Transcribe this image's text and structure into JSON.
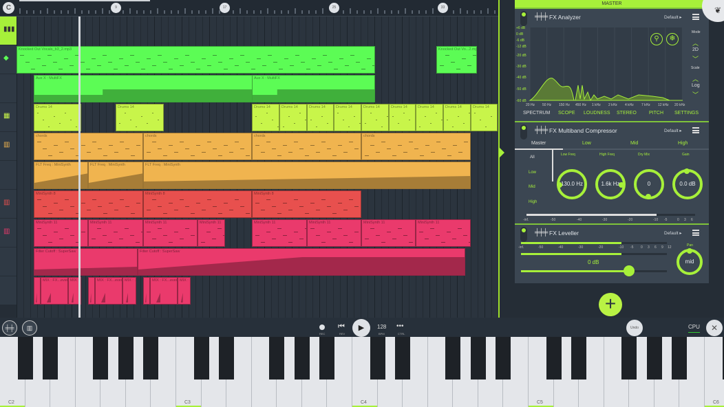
{
  "ruler": {
    "markers": [
      "9",
      "17",
      "25",
      "33"
    ]
  },
  "colors": {
    "accent": "#a7f03a",
    "vocals": "#5cfc55",
    "aux": "#5cfc55",
    "drums": "#c8f54a",
    "chords": "#f0b44f",
    "flt": "#f0b44f",
    "minisynth8": "#e8504e",
    "minisynth11": "#ea3a6c",
    "filter": "#ea3a6c",
    "mix": "#ea3a6c"
  },
  "tracks": [
    {
      "id": "master",
      "icon": "bars-icon",
      "clips": []
    },
    {
      "id": "vocals",
      "icon": "waveform-icon",
      "clips": [
        "Knocked Out Vocals_b3_2.mp3",
        "Knocked Out Vo...2.mp3"
      ]
    },
    {
      "id": "aux",
      "icon": "",
      "clips": [
        "Aux X : MultiFX",
        "Aux X : MultiFX"
      ]
    },
    {
      "id": "drums",
      "icon": "drum-pads-icon",
      "clips": [
        "Drums 14",
        "Drums 14",
        "Drums 14",
        "Drums 14",
        "Drums 14",
        "Drums 14",
        "Drums 14",
        "Drums 14",
        "Drums 14",
        "Drums 14",
        "Drums 14"
      ]
    },
    {
      "id": "chords",
      "icon": "keyboard-icon",
      "clips": [
        "chords",
        "chords",
        "chords",
        "chords"
      ]
    },
    {
      "id": "flt",
      "icon": "",
      "clips": [
        "FLT Freq : MiniSynth",
        "FLT Freq : MiniSynth",
        "FLT Freq : MiniSynth"
      ]
    },
    {
      "id": "minisynth8",
      "icon": "keyboard-icon",
      "clips": [
        "MiniSynth 8",
        "MiniSynth 8",
        "MiniSynth 8"
      ]
    },
    {
      "id": "minisynth11",
      "icon": "keyboard-icon",
      "clips": [
        "MiniSynth 11",
        "MiniSynth 11",
        "MiniSynth 11",
        "MiniSynth 11",
        "MiniSynth 11",
        "MiniSynth 11",
        "MiniSynth 11",
        "MiniSynth 11"
      ]
    },
    {
      "id": "filter",
      "icon": "",
      "clips": [
        "Filter Cutoff : SuperSaw",
        "Filter Cutoff : SuperSaw"
      ]
    },
    {
      "id": "mix",
      "icon": "",
      "clips": [
        "",
        "MIX : FX...everb",
        "MIX : ...",
        "",
        "MIX : FX...everb",
        "MIX : ...",
        "",
        "MIX : FX...everb",
        "MIX : ..."
      ]
    }
  ],
  "master": {
    "title": "MASTER"
  },
  "analyzer": {
    "title": "FX Analyzer",
    "preset": "Default",
    "db_labels": [
      "+6 dB",
      "0 dB",
      "-6 dB",
      "-12 dB",
      "-20 dB",
      "-30 dB",
      "-40 dB",
      "-50 dB",
      "-60 dB"
    ],
    "freq_labels": [
      "20 Hz",
      "50 Hz",
      "150 Hz",
      "450 Hz",
      "1 kHz",
      "2 kHz",
      "4 kHz",
      "7 kHz",
      "12 kHz",
      "20 kHz"
    ],
    "tabs": [
      "SPECTRUM",
      "SCOPE",
      "LOUDNESS",
      "STEREO",
      "PITCH",
      "SETTINGS"
    ],
    "mode_label": "Mode",
    "mode": "2D",
    "scale_label": "Scale",
    "scale": "Log"
  },
  "multiband": {
    "title": "FX Multiband Compressor",
    "preset": "Default",
    "tabs": [
      "Master",
      "Low",
      "Mid",
      "High"
    ],
    "bands": [
      "All",
      "Low",
      "Mid",
      "High"
    ],
    "knobs": [
      {
        "label": "Low Freq",
        "value": "130.0 Hz"
      },
      {
        "label": "High Freq",
        "value": "1.6k Hz"
      },
      {
        "label": "Dry Mix",
        "value": "0"
      },
      {
        "label": "Gain",
        "value": "0.0 dB"
      }
    ],
    "meter_ticks": [
      "-inf.",
      "-50",
      "-40",
      "-30",
      "-20",
      "-10",
      "-5",
      "0",
      "3",
      "6"
    ]
  },
  "leveller": {
    "title": "FX Leveller",
    "preset": "Default",
    "meter_ticks": [
      "-inf.",
      "-50",
      "-40",
      "-30",
      "-20",
      "-10",
      "-5",
      "0",
      "3",
      "6",
      "9",
      "12"
    ],
    "gain": "0 dB",
    "gain_fraction": 0.74,
    "pan_label": "Pan",
    "pan": "mid"
  },
  "transport": {
    "rec": "REC",
    "rev": "REV",
    "bpm": "128",
    "bpm_label": "BPM",
    "ctrl": "CTRL",
    "undo": "Undo",
    "cpu": "CPU"
  },
  "piano": {
    "labels": [
      "C2",
      "C3",
      "C4",
      "C5",
      "C6"
    ]
  }
}
